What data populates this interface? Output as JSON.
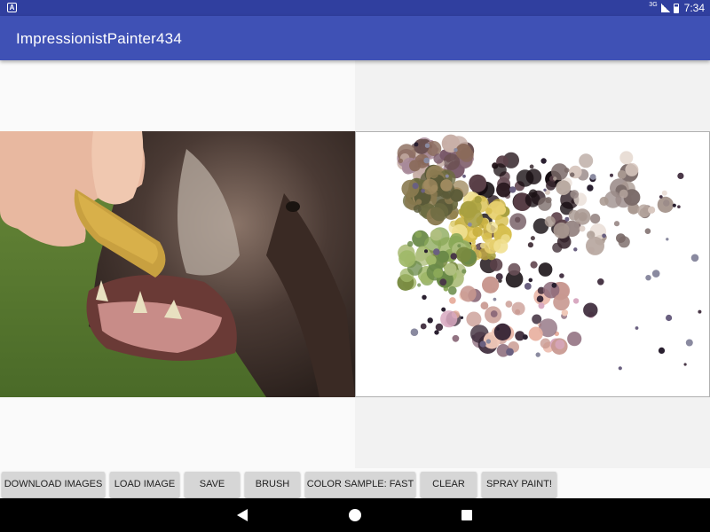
{
  "status_bar": {
    "network_label": "3G",
    "time": "7:34",
    "notification_icon": "a-icon"
  },
  "app_bar": {
    "title": "ImpressionistPainter434"
  },
  "image_panes": {
    "source_image_subject": "dog",
    "painted_canvas": "impressionist dots"
  },
  "toolbar": {
    "buttons": [
      {
        "label": "DOWNLOAD IMAGES"
      },
      {
        "label": "LOAD IMAGE"
      },
      {
        "label": "SAVE"
      },
      {
        "label": "BRUSH"
      },
      {
        "label": "COLOR SAMPLE: FAST"
      },
      {
        "label": "CLEAR"
      },
      {
        "label": "SPRAY PAINT!"
      }
    ]
  },
  "nav_bar": {
    "icons": [
      "back-icon",
      "home-icon",
      "recent-apps-icon"
    ]
  },
  "colors": {
    "status_bar": "#303f9f",
    "app_bar": "#3f51b5",
    "button": "#d6d6d6"
  }
}
